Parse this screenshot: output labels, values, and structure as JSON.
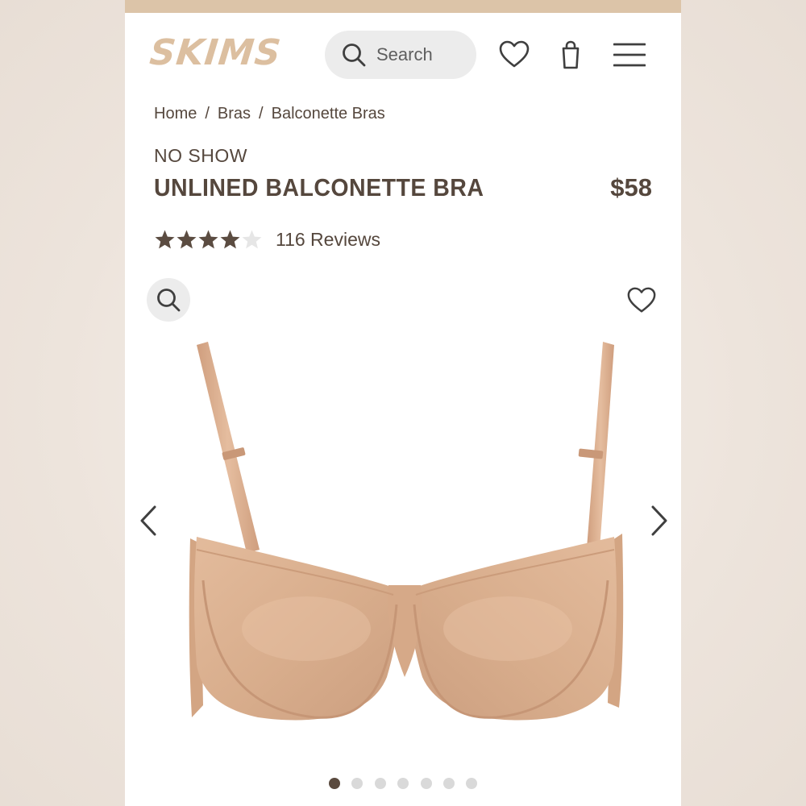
{
  "header": {
    "logo_text": "SKIMS",
    "search_placeholder": "Search",
    "icons": [
      "search-icon",
      "heart-icon",
      "shopping-bag-icon",
      "hamburger-menu-icon"
    ]
  },
  "breadcrumb": [
    "Home",
    "Bras",
    "Balconette Bras"
  ],
  "product": {
    "collection": "NO SHOW",
    "title": "UNLINED BALCONETTE BRA",
    "price": "$58",
    "rating_stars": 4,
    "rating_max": 5,
    "reviews_label": "116 Reviews"
  },
  "gallery": {
    "image_count": 7,
    "active_index": 0,
    "icons": [
      "zoom-icon",
      "heart-icon",
      "chevron-left-icon",
      "chevron-right-icon"
    ]
  },
  "colors": {
    "brand": "#dcbfa0",
    "topbar": "#dcc4a8",
    "text": "#55473d",
    "star_filled": "#5b4c41",
    "star_empty": "#e6e6e6",
    "pill_bg": "#ececec",
    "product_nude": "#dcb191"
  }
}
